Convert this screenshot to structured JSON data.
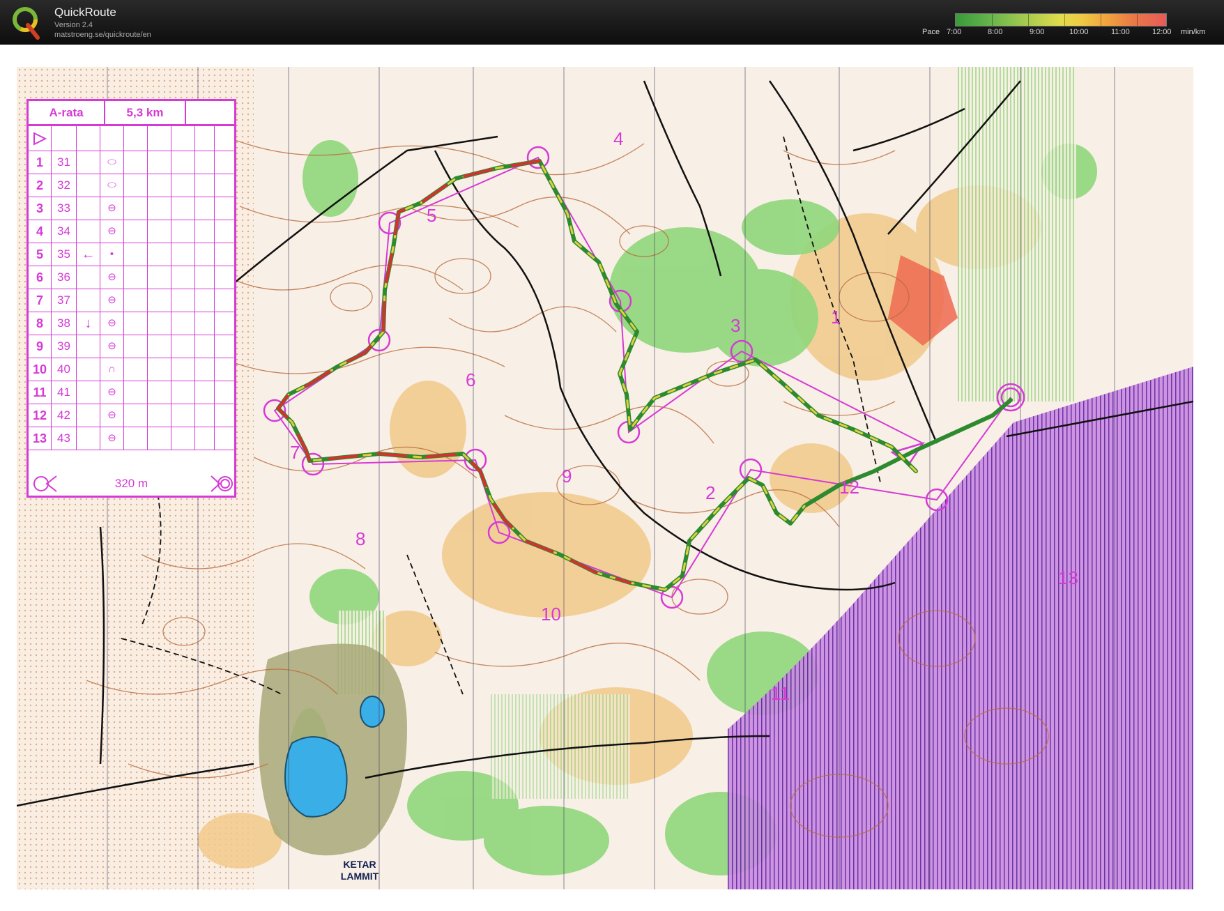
{
  "header": {
    "app_title": "QuickRoute",
    "version": "Version 2.4",
    "url": "matstroeng.se/quickroute/en",
    "pace_label": "Pace",
    "pace_ticks": [
      "7:00",
      "8:00",
      "9:00",
      "10:00",
      "11:00",
      "12:00"
    ],
    "pace_unit": "min/km"
  },
  "control_card": {
    "course_name": "A-rata",
    "course_length": "5,3 km",
    "controls": [
      {
        "num": "1",
        "code": "31",
        "dir": "",
        "feature": "⬭"
      },
      {
        "num": "2",
        "code": "32",
        "dir": "",
        "feature": "⬭"
      },
      {
        "num": "3",
        "code": "33",
        "dir": "",
        "feature": "⊖"
      },
      {
        "num": "4",
        "code": "34",
        "dir": "",
        "feature": "⊖"
      },
      {
        "num": "5",
        "code": "35",
        "dir": "←",
        "feature": "•"
      },
      {
        "num": "6",
        "code": "36",
        "dir": "",
        "feature": "⊖"
      },
      {
        "num": "7",
        "code": "37",
        "dir": "",
        "feature": "⊖"
      },
      {
        "num": "8",
        "code": "38",
        "dir": "↓",
        "feature": "⊖"
      },
      {
        "num": "9",
        "code": "39",
        "dir": "",
        "feature": "⊖"
      },
      {
        "num": "10",
        "code": "40",
        "dir": "",
        "feature": "∩"
      },
      {
        "num": "11",
        "code": "41",
        "dir": "",
        "feature": "⊖"
      },
      {
        "num": "12",
        "code": "42",
        "dir": "",
        "feature": "⊖"
      },
      {
        "num": "13",
        "code": "43",
        "dir": "",
        "feature": "⊖"
      }
    ],
    "finish_distance": "320 m"
  },
  "map": {
    "control_labels": [
      "1",
      "2",
      "3",
      "4",
      "5",
      "6",
      "7",
      "8",
      "9",
      "10",
      "11",
      "12",
      "13"
    ],
    "lake_label_line1": "KETAR",
    "lake_label_line2": "LAMMIT",
    "colors": {
      "course": "#d63ad6",
      "route_fast": "#2e8a2e",
      "route_mid": "#e0d040",
      "route_slow": "#d63030",
      "contour": "#b86a3a",
      "green_veg": "#8fd67a",
      "open_land": "#f2c98a",
      "settlement": "#8a2fbf",
      "water": "#3aaee6"
    }
  }
}
